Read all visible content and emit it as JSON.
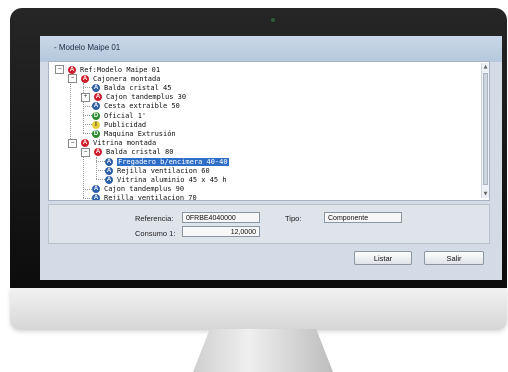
{
  "window": {
    "title": "- Modelo Maipe 01"
  },
  "tree": [
    {
      "label": "Ref:Modelo Maipe 01",
      "badge": "A",
      "color": "red",
      "toggle": "-",
      "level": 0
    },
    {
      "label": "Cajonera montada",
      "badge": "A",
      "color": "red",
      "toggle": "-",
      "level": 1
    },
    {
      "label": "Balda cristal 45",
      "badge": "A",
      "color": "blue",
      "toggle": "",
      "level": 2
    },
    {
      "label": "Cajon tandemplus 30",
      "badge": "A",
      "color": "red",
      "toggle": "+",
      "level": 2
    },
    {
      "label": "Cesta extraible 50",
      "badge": "A",
      "color": "blue",
      "toggle": "",
      "level": 2
    },
    {
      "label": "Oficial 1'",
      "badge": "D",
      "color": "green",
      "toggle": "",
      "level": 2
    },
    {
      "label": "Publicidad",
      "badge": "I",
      "color": "yellow",
      "toggle": "",
      "level": 2
    },
    {
      "label": "Maquina Extrusión",
      "badge": "D",
      "color": "green",
      "toggle": "",
      "level": 2
    },
    {
      "label": "Vitrina montada",
      "badge": "A",
      "color": "red",
      "toggle": "-",
      "level": 1
    },
    {
      "label": "Balda cristal 80",
      "badge": "A",
      "color": "red",
      "toggle": "-",
      "level": 2
    },
    {
      "label": "Fregadero b/encimera 40-40",
      "badge": "A",
      "color": "blue",
      "toggle": "",
      "level": 3,
      "selected": true
    },
    {
      "label": "Rejilla ventilacion 60",
      "badge": "A",
      "color": "blue",
      "toggle": "",
      "level": 3
    },
    {
      "label": "Vitrina aluminio 45 x 45 h",
      "badge": "A",
      "color": "blue",
      "toggle": "",
      "level": 3
    },
    {
      "label": "Cajon tandemplus 90",
      "badge": "A",
      "color": "blue",
      "toggle": "",
      "level": 2
    },
    {
      "label": "Rejilla ventilacion 70",
      "badge": "A",
      "color": "blue",
      "toggle": "",
      "level": 2
    }
  ],
  "form": {
    "referencia_label": "Referencia:",
    "referencia_value": "0FRBE4040000",
    "tipo_label": "Tipo:",
    "tipo_value": "Componente",
    "consumo_label": "Consumo 1:",
    "consumo_value": "12,0000"
  },
  "buttons": {
    "listar": "Listar",
    "salir": "Salir"
  },
  "colors": {
    "selection": "#2f6ec8",
    "badge_red": "#cf1d2c",
    "badge_blue": "#2d5ea8",
    "badge_green": "#2f8a2f",
    "badge_yellow": "#e7cf3b"
  }
}
